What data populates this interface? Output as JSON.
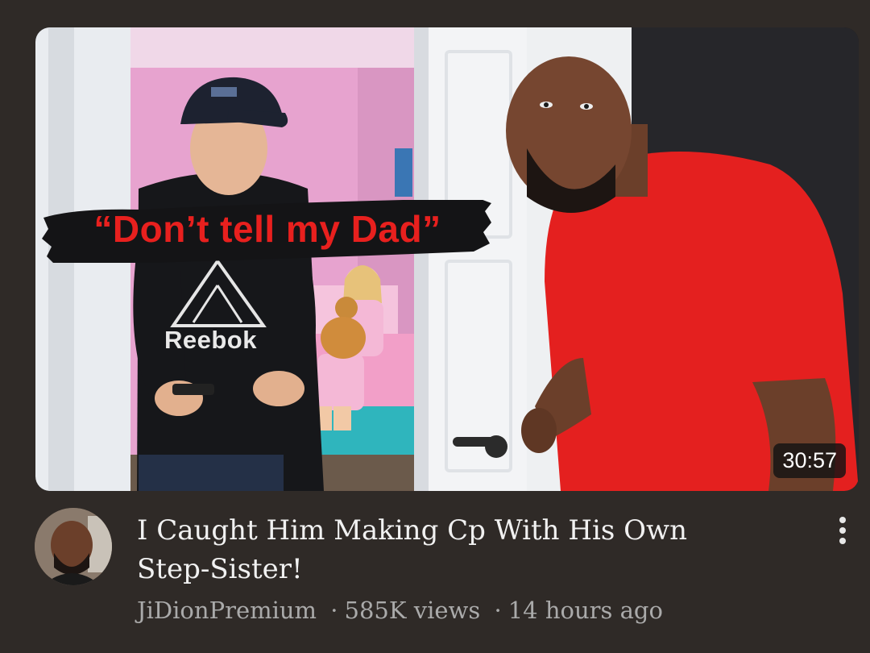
{
  "video": {
    "thumbnail_overlay": "“Don’t tell my Dad”",
    "thumbnail_brand": "Reebok",
    "duration": "30:57",
    "title": "I Caught Him Making Cp With His Own Step-Sister!",
    "channel": "JiDionPremium",
    "views": "585K views",
    "age": "14 hours ago",
    "separator": "·"
  },
  "icons": {
    "more": "more-vertical-icon"
  },
  "colors": {
    "background": "#2f2a27",
    "overlay_text": "#e8201e",
    "title": "#f1f1f1",
    "meta": "#aaaaaa"
  }
}
